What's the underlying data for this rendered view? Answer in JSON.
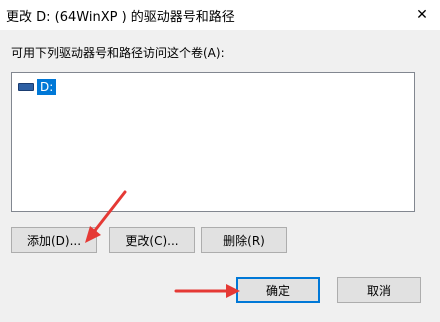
{
  "window": {
    "title": "更改 D: (64WinXP ) 的驱动器号和路径",
    "close_glyph": "✕"
  },
  "main": {
    "list_label": "可用下列驱动器号和路径访问这个卷(A):",
    "list_items": [
      {
        "label": "D:",
        "icon": "drive-icon",
        "selected": true
      }
    ]
  },
  "buttons": {
    "add": "添加(D)...",
    "change": "更改(C)...",
    "remove": "删除(R)",
    "ok": "确定",
    "cancel": "取消"
  },
  "colors": {
    "selection": "#0078d7",
    "annotation_arrow": "#e53935",
    "dialog_background": "#f0f0f0"
  }
}
